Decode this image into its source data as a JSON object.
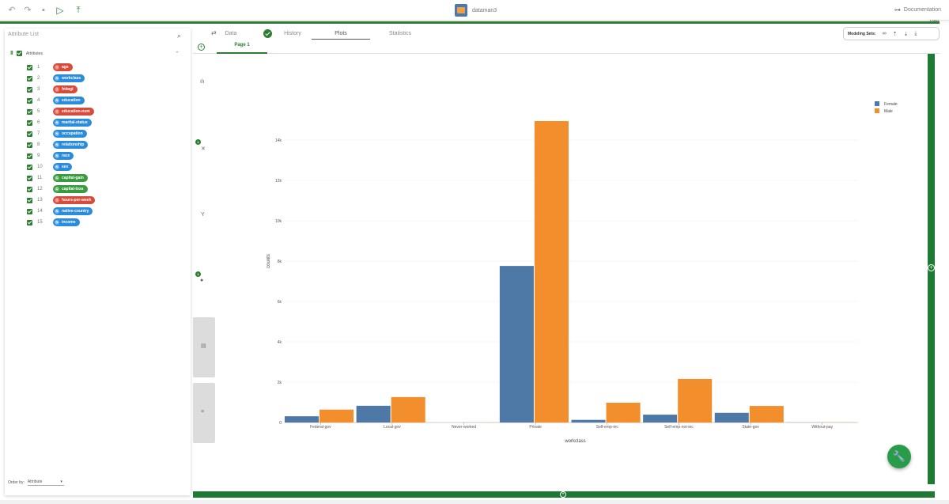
{
  "toolbar": {
    "app_title": "dataman3",
    "documentation_label": "Documentation",
    "progress_label": "100%",
    "progress_value": 100
  },
  "left_panel": {
    "title": "Attribute List",
    "group_label": "Attributes",
    "order_by_label": "Order by:",
    "order_by_value": "Attribute",
    "attributes": [
      {
        "index": "1",
        "name": "age",
        "type": "integer",
        "type_letter": "I"
      },
      {
        "index": "2",
        "name": "workclass",
        "type": "nominal",
        "type_letter": "N"
      },
      {
        "index": "3",
        "name": "fnlwgt",
        "type": "integer",
        "type_letter": "I"
      },
      {
        "index": "4",
        "name": "education",
        "type": "nominal",
        "type_letter": "N"
      },
      {
        "index": "5",
        "name": "education-num",
        "type": "integer",
        "type_letter": "I"
      },
      {
        "index": "6",
        "name": "marital-status",
        "type": "nominal",
        "type_letter": "N"
      },
      {
        "index": "7",
        "name": "occupation",
        "type": "nominal",
        "type_letter": "N"
      },
      {
        "index": "8",
        "name": "relationship",
        "type": "nominal",
        "type_letter": "N"
      },
      {
        "index": "9",
        "name": "race",
        "type": "nominal",
        "type_letter": "N"
      },
      {
        "index": "10",
        "name": "sex",
        "type": "nominal",
        "type_letter": "N"
      },
      {
        "index": "11",
        "name": "capital-gain",
        "type": "continuous",
        "type_letter": "C"
      },
      {
        "index": "12",
        "name": "capital-loss",
        "type": "continuous",
        "type_letter": "C"
      },
      {
        "index": "13",
        "name": "hours-per-week",
        "type": "integer",
        "type_letter": "I"
      },
      {
        "index": "14",
        "name": "native-country",
        "type": "nominal",
        "type_letter": "N"
      },
      {
        "index": "15",
        "name": "income",
        "type": "nominal",
        "type_letter": "N"
      }
    ]
  },
  "tabs": [
    {
      "label": "Data"
    },
    {
      "label": "History"
    },
    {
      "label": "Plots"
    },
    {
      "label": "Statistics"
    }
  ],
  "active_tab": "Plots",
  "page_tab": "Page 1",
  "modeling_sets_label": "Modeling Sets:",
  "mini_toolbar": {
    "badge_1": "1",
    "badge_2": "1"
  },
  "colors": {
    "accent": "#2e7d32",
    "female": "#4e79a7",
    "male": "#f28e2b",
    "integer": "#d84b3a",
    "nominal": "#2b8cdc",
    "continuous": "#3a9a3f"
  },
  "chart_data": {
    "type": "bar",
    "xlabel": "workclass",
    "ylabel": "counts",
    "categories": [
      "Federal-gov",
      "Local-gov",
      "Never-worked",
      "Private",
      "Self-emp-inc",
      "Self-emp-not-inc",
      "State-gov",
      "Without-pay"
    ],
    "series": [
      {
        "name": "Female",
        "color": "#4e79a7",
        "values": [
          310,
          830,
          0,
          7760,
          130,
          390,
          480,
          5
        ]
      },
      {
        "name": "Male",
        "color": "#f28e2b",
        "values": [
          640,
          1260,
          5,
          14940,
          980,
          2160,
          820,
          10
        ]
      }
    ],
    "ylim": [
      0,
      16000
    ],
    "y_ticks": [
      0,
      2000,
      4000,
      6000,
      8000,
      10000,
      12000,
      14000
    ],
    "y_tick_labels": [
      "0",
      "2k",
      "4k",
      "6k",
      "8k",
      "10k",
      "12k",
      "14k"
    ],
    "grid": true,
    "legend_position": "top-right"
  }
}
